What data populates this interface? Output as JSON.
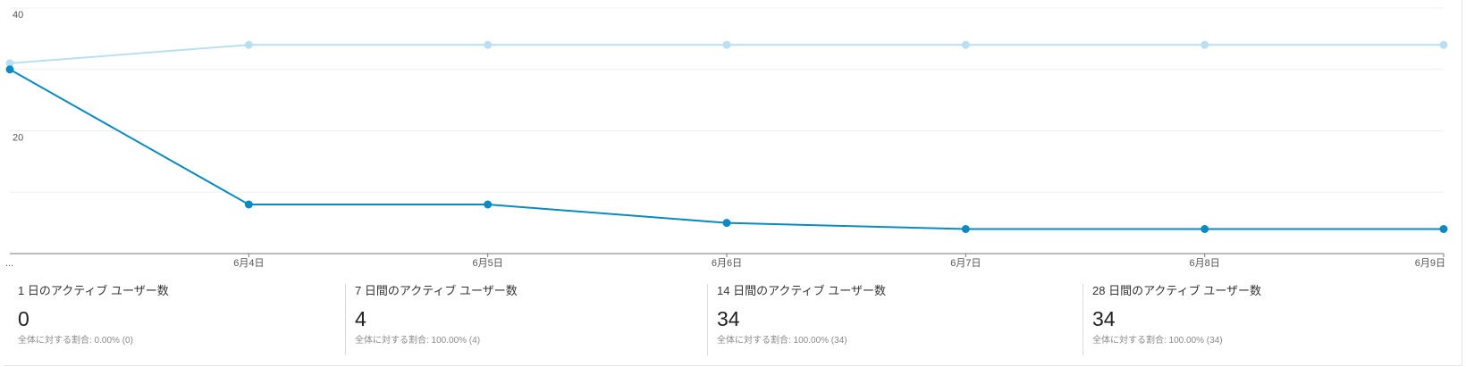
{
  "chart_data": {
    "type": "line",
    "categories": [
      "...",
      "6月4日",
      "6月5日",
      "6月6日",
      "6月7日",
      "6月8日",
      "6月9日"
    ],
    "series": [
      {
        "color": "#b9dff0",
        "values": [
          31,
          34,
          34,
          34,
          34,
          34,
          34
        ]
      },
      {
        "color": "#0a8ac2",
        "values": [
          30,
          8,
          8,
          5,
          4,
          4,
          4
        ]
      }
    ],
    "yticks": [
      "20",
      "40"
    ],
    "ylim": [
      0,
      40
    ],
    "grid": true,
    "title": "",
    "xlabel": "",
    "ylabel": ""
  },
  "metrics": [
    {
      "label": "1 日のアクティブ ユーザー数",
      "value": "0",
      "share": "全体に対する割合: 0.00% (0)"
    },
    {
      "label": "7 日間のアクティブ ユーザー数",
      "value": "4",
      "share": "全体に対する割合: 100.00% (4)"
    },
    {
      "label": "14 日間のアクティブ ユーザー数",
      "value": "34",
      "share": "全体に対する割合: 100.00% (34)"
    },
    {
      "label": "28 日間のアクティブ ユーザー数",
      "value": "34",
      "share": "全体に対する割合: 100.00% (34)"
    }
  ]
}
